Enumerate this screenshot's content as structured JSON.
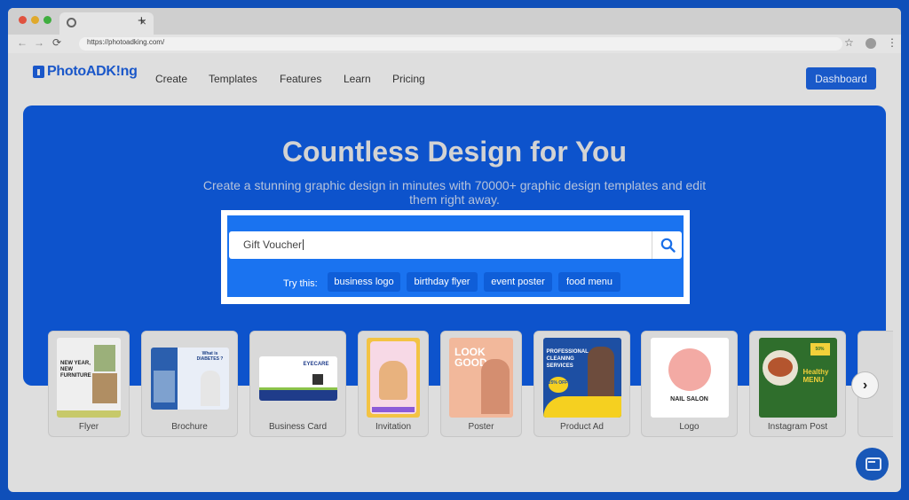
{
  "browser": {
    "url": "https://photoadking.com/",
    "new_tab_icon": "+",
    "close_tab_icon": "×"
  },
  "site": {
    "logo_text": "PhotoADK!ng",
    "nav": [
      "Create",
      "Templates",
      "Features",
      "Learn",
      "Pricing"
    ],
    "dashboard_label": "Dashboard"
  },
  "hero": {
    "title": "Countless Design for You",
    "subtitle": "Create a stunning graphic design in minutes with 70000+ graphic design templates and edit them right away.",
    "search_value": "Gift Voucher",
    "try_label": "Try this:",
    "suggestions": [
      "business logo",
      "birthday flyer",
      "event poster",
      "food menu"
    ]
  },
  "categories": [
    "Flyer",
    "Brochure",
    "Business Card",
    "Invitation",
    "Poster",
    "Product Ad",
    "Logo",
    "Instagram Post"
  ],
  "thumb_text": {
    "flyer": "NEW YEAR, NEW FURNITURE",
    "brochure": "What is DIABETES ?",
    "business_card": "EYECARE",
    "poster": "LOOK GOOD",
    "product_ad": "PROFESSIONAL CLEANING SERVICES",
    "product_ad_badge": "25% OFF",
    "logo": "NAIL SALON",
    "instagram": "Healthy MENU",
    "instagram_badge": "50%"
  },
  "colors": {
    "brand_blue": "#0d53cc",
    "search_blue": "#1a73f0",
    "chip_blue": "#0f5ed8"
  }
}
